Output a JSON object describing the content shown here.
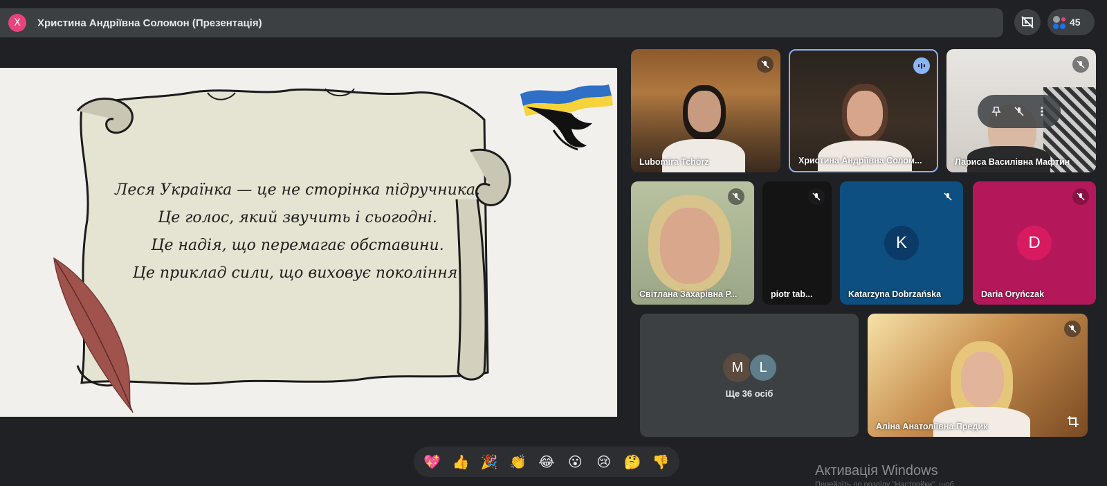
{
  "header": {
    "close_label": "X",
    "title": "Христина Андріївна Соломон (Презентація)",
    "participants_count": "45"
  },
  "slide": {
    "lines": [
      "Леся Українка — це не сторінка підручника.",
      "Це голос, який звучить і сьогодні.",
      "Це надія, що перемагає обставини.",
      "Це приклад сили, що виховує покоління."
    ]
  },
  "participants": {
    "t1": "Lubomira Tchórz",
    "t2": "Христина Андріївна Солом...",
    "t3": "Лариса Василівна Мафтин",
    "t4": "Світлана Захарівна Р...",
    "t5": "piotr tab...",
    "t6": "Katarzyna Dobrzańska",
    "t6_initial": "K",
    "t7": "Daria Oryńczak",
    "t7_initial": "D",
    "t9": "Аліна Анатоліївна Предик"
  },
  "others": {
    "avatar1": "M",
    "avatar2": "L",
    "label": "Ще 36 осіб"
  },
  "reactions": [
    "💖",
    "👍",
    "🎉",
    "👏",
    "😂",
    "😮",
    "😢",
    "🤔",
    "👎"
  ],
  "windows": {
    "title": "Активація Windows",
    "subtitle": "Перейдіть до розділу \"Настройки\", щоб"
  },
  "colors": {
    "accent_pink": "#e8437a",
    "katarzyna_bg": "#0d4f80",
    "daria_bg": "#b5185a",
    "ukraine_blue": "#2f6fc6",
    "ukraine_yellow": "#f6d33a"
  }
}
